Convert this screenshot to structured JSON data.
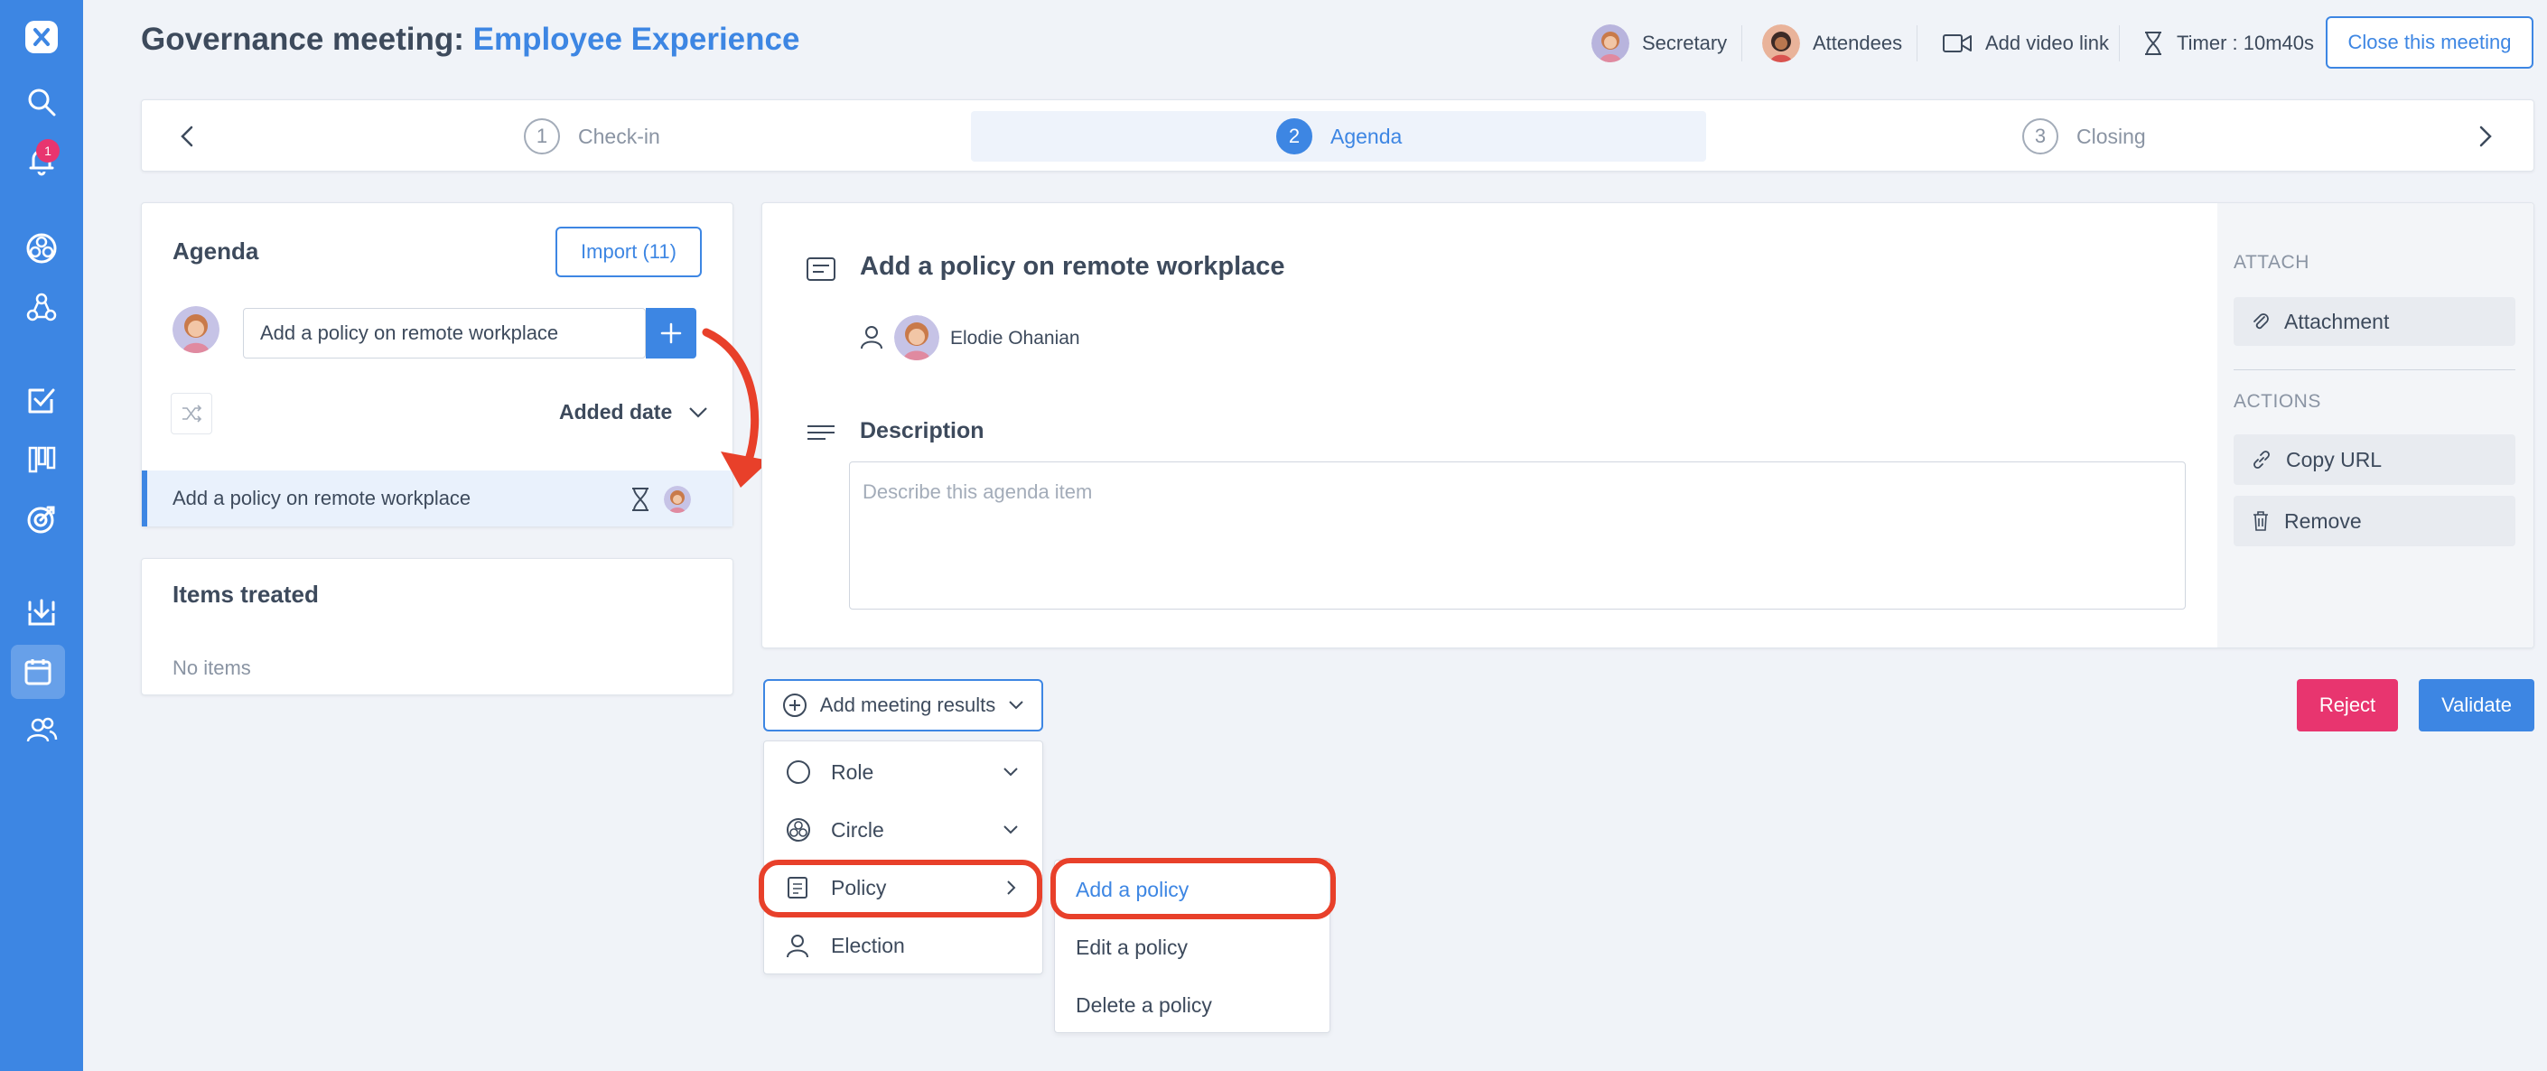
{
  "header": {
    "title_prefix": "Governance meeting: ",
    "title_highlight": "Employee Experience",
    "secretary": "Secretary",
    "attendees": "Attendees",
    "video": "Add video link",
    "timer": "Timer : 10m40s",
    "close": "Close this meeting"
  },
  "nav": {
    "notification_count": "1"
  },
  "stepper": {
    "steps": [
      {
        "num": "1",
        "label": "Check-in"
      },
      {
        "num": "2",
        "label": "Agenda"
      },
      {
        "num": "3",
        "label": "Closing"
      }
    ]
  },
  "agenda": {
    "title": "Agenda",
    "import": "Import (11)",
    "input_value": "Add a policy on remote workplace",
    "sort_label": "Added date",
    "item": "Add a policy on remote workplace"
  },
  "treated": {
    "title": "Items treated",
    "empty": "No items"
  },
  "detail": {
    "title": "Add a policy on remote workplace",
    "owner": "Elodie Ohanian",
    "desc_label": "Description",
    "desc_placeholder": "Describe this agenda item"
  },
  "side": {
    "attach_label": "ATTACH",
    "attachment": "Attachment",
    "actions_label": "ACTIONS",
    "copy_url": "Copy URL",
    "remove": "Remove"
  },
  "results": {
    "button": "Add meeting results",
    "menu": [
      "Role",
      "Circle",
      "Policy",
      "Election"
    ],
    "submenu": [
      "Add a policy",
      "Edit a policy",
      "Delete a policy"
    ]
  },
  "footer": {
    "reject": "Reject",
    "validate": "Validate"
  },
  "colors": {
    "accent": "#3d86e3",
    "reject": "#e8356f",
    "highlight_ring": "#e8402a"
  }
}
